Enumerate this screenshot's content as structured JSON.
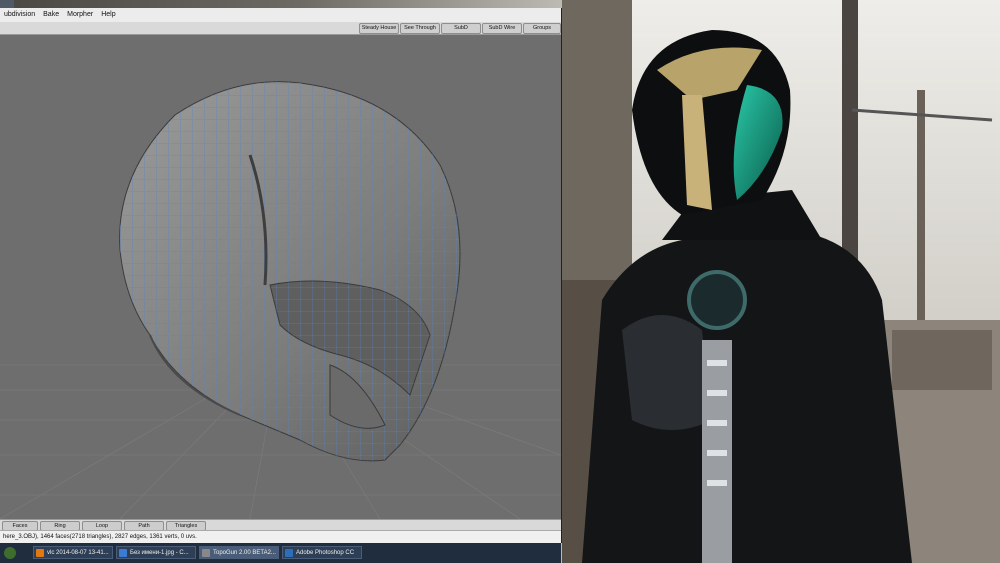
{
  "menubar": {
    "items": [
      "ubdivision",
      "Bake",
      "Morpher",
      "Help"
    ]
  },
  "toolbar": {
    "buttons": [
      "Steady House",
      "See Through",
      "SubD",
      "SubD Wire",
      "Groups"
    ]
  },
  "bottombar": {
    "buttons": [
      "Faces",
      "Ring",
      "Loop",
      "Path",
      "Triangles"
    ]
  },
  "status": {
    "text": "here_3.OBJ), 1464 faces(2718 triangles), 2827 edges, 1361 verts, 0 uvs."
  },
  "taskbar": {
    "tasks": [
      {
        "label": "vlc 2014-08-07 13-41...",
        "color": "#e07a10"
      },
      {
        "label": "Без имени-1.jpg - C...",
        "color": "#3b7bd1"
      },
      {
        "label": "TopoGun 2.00 BETA2...",
        "color": "#888888"
      },
      {
        "label": "Adobe Photoshop CC",
        "color": "#2c6fb8"
      }
    ]
  },
  "colors": {
    "wire": "#4e86c8",
    "viewport_bg": "#6e6e6e",
    "mesh": "#8a8a8a"
  }
}
